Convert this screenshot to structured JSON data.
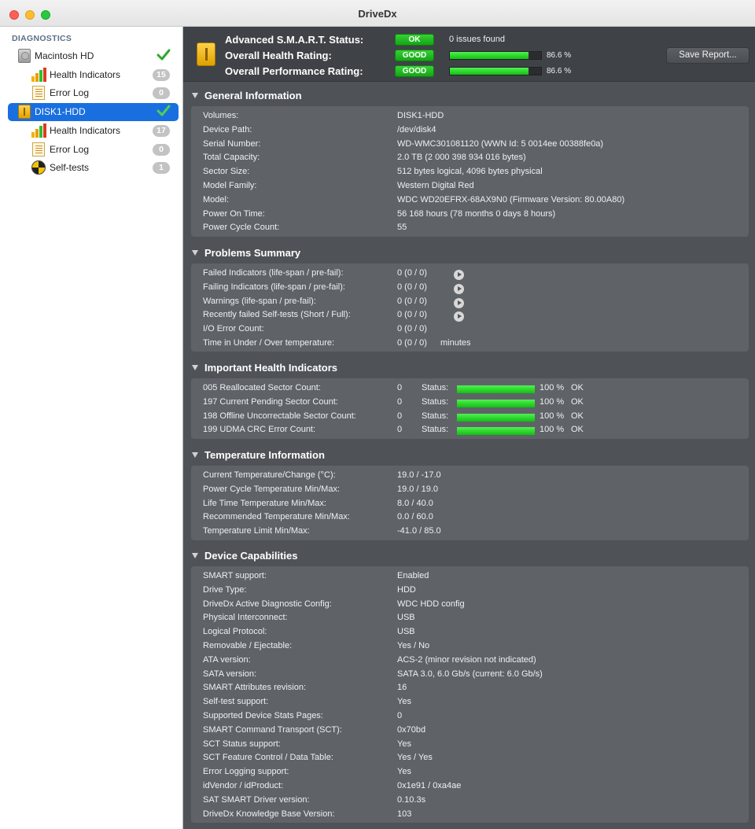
{
  "window": {
    "title": "DriveDx"
  },
  "sidebar": {
    "heading": "DIAGNOSTICS",
    "drives": [
      {
        "label": "Macintosh HD",
        "status": "ok",
        "items": [
          {
            "label": "Health Indicators",
            "icon": "health-bars-icon",
            "badge": "15"
          },
          {
            "label": "Error Log",
            "icon": "document-icon",
            "badge": "0"
          }
        ]
      },
      {
        "label": "DISK1-HDD",
        "status": "ok",
        "selected": true,
        "items": [
          {
            "label": "Health Indicators",
            "icon": "health-bars-icon",
            "badge": "17"
          },
          {
            "label": "Error Log",
            "icon": "document-icon",
            "badge": "0"
          },
          {
            "label": "Self-tests",
            "icon": "self-test-icon",
            "badge": "1"
          }
        ]
      }
    ]
  },
  "header": {
    "smart_status": {
      "label": "Advanced S.M.A.R.T. Status:",
      "pill": "OK",
      "text": "0 issues found"
    },
    "health_rating": {
      "label": "Overall Health Rating:",
      "pill": "GOOD",
      "percent_text": "86.6 %",
      "value": 0.866
    },
    "performance_rating": {
      "label": "Overall Performance Rating:",
      "pill": "GOOD",
      "percent_text": "86.6 %",
      "value": 0.866
    },
    "save_report": "Save Report..."
  },
  "general_info": {
    "title": "General Information",
    "rows": [
      {
        "label": "Volumes:",
        "value": "DISK1-HDD"
      },
      {
        "label": "Device Path:",
        "value": "/dev/disk4"
      },
      {
        "label": "Serial Number:",
        "value": "WD-WMC301081120 (WWN Id: 5 0014ee 00388fe0a)"
      },
      {
        "label": "Total Capacity:",
        "value": "2.0 TB (2 000 398 934 016 bytes)"
      },
      {
        "label": "Sector Size:",
        "value": "512 bytes logical, 4096 bytes physical"
      },
      {
        "label": "Model Family:",
        "value": "Western Digital Red"
      },
      {
        "label": "Model:",
        "value": "WDC WD20EFRX-68AX9N0  (Firmware Version: 80.00A80)"
      },
      {
        "label": "Power On Time:",
        "value": "56 168 hours (78 months 0 days 8 hours)"
      },
      {
        "label": "Power Cycle Count:",
        "value": "55"
      }
    ]
  },
  "problems": {
    "title": "Problems Summary",
    "rows": [
      {
        "label": "Failed Indicators (life-span / pre-fail):",
        "value": "0 (0 / 0)",
        "has_arrow": true
      },
      {
        "label": "Failing Indicators (life-span / pre-fail):",
        "value": "0 (0 / 0)",
        "has_arrow": true
      },
      {
        "label": "Warnings (life-span / pre-fail):",
        "value": "0 (0 / 0)",
        "has_arrow": true
      },
      {
        "label": "Recently failed Self-tests (Short / Full):",
        "value": "0 (0 / 0)",
        "has_arrow": true
      },
      {
        "label": "I/O Error Count:",
        "value": "0 (0 / 0)"
      },
      {
        "label": "Time in Under / Over temperature:",
        "value": "0 (0 / 0)",
        "extra": "minutes"
      }
    ]
  },
  "health_indicators": {
    "title": "Important Health Indicators",
    "status_label": "Status:",
    "rows": [
      {
        "label": "005  Reallocated Sector Count:",
        "value": "0",
        "percent_text": "100 %",
        "level": 1.0,
        "state": "OK"
      },
      {
        "label": "197  Current Pending Sector Count:",
        "value": "0",
        "percent_text": "100 %",
        "level": 1.0,
        "state": "OK"
      },
      {
        "label": "198  Offline Uncorrectable Sector Count:",
        "value": "0",
        "percent_text": "100 %",
        "level": 1.0,
        "state": "OK"
      },
      {
        "label": "199  UDMA CRC Error Count:",
        "value": "0",
        "percent_text": "100 %",
        "level": 1.0,
        "state": "OK"
      }
    ]
  },
  "temperature": {
    "title": "Temperature Information",
    "rows": [
      {
        "label": "Current Temperature/Change (°C):",
        "value": "19.0   / -17.0"
      },
      {
        "label": "Power Cycle Temperature Min/Max:",
        "value": "19.0   / 19.0"
      },
      {
        "label": "Life Time Temperature Min/Max:",
        "value": "8.0     / 40.0"
      },
      {
        "label": "Recommended Temperature Min/Max:",
        "value": "0.0     / 60.0"
      },
      {
        "label": "Temperature Limit Min/Max:",
        "value": "-41.0 / 85.0"
      }
    ]
  },
  "capabilities": {
    "title": "Device Capabilities",
    "rows": [
      {
        "label": "SMART support:",
        "value": "Enabled"
      },
      {
        "label": "Drive Type:",
        "value": "HDD"
      },
      {
        "label": "DriveDx Active Diagnostic Config:",
        "value": "WDC HDD config"
      },
      {
        "label": "Physical Interconnect:",
        "value": "USB"
      },
      {
        "label": "Logical Protocol:",
        "value": "USB"
      },
      {
        "label": "Removable / Ejectable:",
        "value": "Yes / No"
      },
      {
        "label": "ATA version:",
        "value": "ACS-2 (minor revision not indicated)"
      },
      {
        "label": "SATA version:",
        "value": "SATA 3.0, 6.0 Gb/s (current: 6.0 Gb/s)"
      },
      {
        "label": "SMART Attributes revision:",
        "value": "16"
      },
      {
        "label": "Self-test support:",
        "value": "Yes"
      },
      {
        "label": "Supported Device Stats Pages:",
        "value": "0"
      },
      {
        "label": "SMART Command Transport (SCT):",
        "value": "0x70bd"
      },
      {
        "label": "SCT Status support:",
        "value": "Yes"
      },
      {
        "label": "SCT Feature Control / Data Table:",
        "value": "Yes / Yes"
      },
      {
        "label": "Error Logging support:",
        "value": "Yes"
      },
      {
        "label": "idVendor / idProduct:",
        "value": "0x1e91 / 0xa4ae"
      },
      {
        "label": "SAT SMART Driver version:",
        "value": "0.10.3s"
      },
      {
        "label": "DriveDx Knowledge Base Version:",
        "value": "103"
      }
    ]
  },
  "colors": {
    "accent": "#1a6fe0",
    "ok_green": "#14a514",
    "panel": "#5f6368",
    "background": "#4f5358"
  }
}
